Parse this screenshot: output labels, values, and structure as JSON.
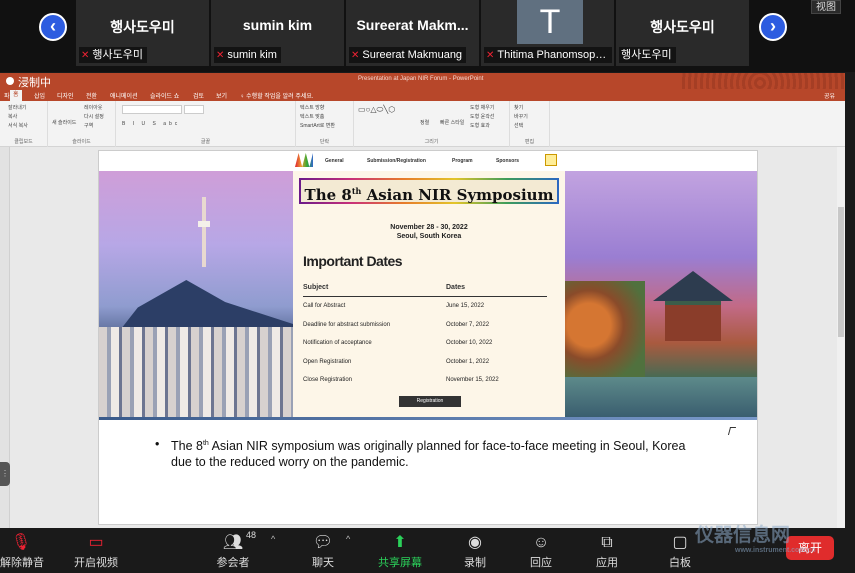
{
  "participants": {
    "tiles": [
      {
        "display_name": "행사도우미",
        "label": "행사도우미",
        "muted": true
      },
      {
        "display_name": "sumin kim",
        "label": "sumin kim",
        "muted": true
      },
      {
        "display_name": "Sureerat  Makm...",
        "label": "Sureerat Makmuang",
        "muted": true
      },
      {
        "display_name": "T",
        "label": "Thitima Phanomsoph...",
        "muted": true
      },
      {
        "display_name": "행사도우미",
        "label": "행사도우미",
        "muted": false
      }
    ],
    "prev_label": "‹",
    "next_label": "›",
    "view_label": "视图"
  },
  "powerpoint": {
    "app_title": "浸制中",
    "document_title": "Presentation at Japan NIR Forum - PowerPoint",
    "tabs": [
      "파일",
      "홈",
      "삽입",
      "디자인",
      "전환",
      "애니메이션",
      "슬라이드 쇼",
      "검토",
      "보기",
      "♀ 수행할 작업을 알려 주세요."
    ],
    "share_label": "공유",
    "ribbon_groups": [
      "클립보드",
      "슬라이드",
      "글꼴",
      "단락",
      "그리기",
      "편집"
    ],
    "ribbon_items": {
      "clipboard": [
        "잘라내기",
        "복사",
        "서식 복사"
      ],
      "slides": [
        "새 슬라이드",
        "레이아웃",
        "다시 설정",
        "구역"
      ],
      "paragraph": [
        "텍스트 방향",
        "텍스트 맞춤",
        "SmartArt로 변환"
      ],
      "drawing": [
        "정렬",
        "빠른 스타일",
        "도형 채우기",
        "도형 윤곽선",
        "도형 효과"
      ],
      "editing": [
        "찾기",
        "바꾸기",
        "선택"
      ]
    }
  },
  "slide": {
    "nav": [
      "General",
      "Submission/Registration",
      "Program",
      "Sponsors"
    ],
    "banner_title_pre": "The 8",
    "banner_title_sup": "th",
    "banner_title_post": " Asian NIR Symposium",
    "event_dates": "November 28 - 30, 2022",
    "event_location": "Seoul, South Korea",
    "important_dates_title": "Important Dates",
    "table_headers": {
      "subject": "Subject",
      "dates": "Dates"
    },
    "rows": [
      {
        "subject": "Call for Abstract",
        "date": "June 15, 2022"
      },
      {
        "subject": "Deadline for abstract submission",
        "date": "October 7, 2022"
      },
      {
        "subject": "Notification of acceptance",
        "date": "October 10, 2022"
      },
      {
        "subject": "Open Registration",
        "date": "October 1, 2022"
      },
      {
        "subject": "Close Registration",
        "date": "November 15, 2022"
      }
    ],
    "registration_button": "Registration",
    "bullet_pre": "The 8",
    "bullet_sup": "th",
    "bullet_post": " Asian NIR symposium was originally planned for face-to-face meeting in Seoul, Korea due to the reduced worry on the pandemic."
  },
  "toolbar": {
    "unmute": "解除静音",
    "start_video": "开启视频",
    "participants": "参会者",
    "participants_count": "48",
    "chat": "聊天",
    "share_screen": "共享屏幕",
    "record": "录制",
    "reactions": "回应",
    "apps": "应用",
    "whiteboard": "白板",
    "leave": "离开"
  },
  "watermark": {
    "text": "仪器信息网",
    "url": "www.instrument.com.cn"
  },
  "colors": {
    "ppt_accent": "#b7472a",
    "zoom_blue": "#2d5ce0",
    "share_green": "#2bd15a",
    "leave_red": "#e02c2c"
  }
}
